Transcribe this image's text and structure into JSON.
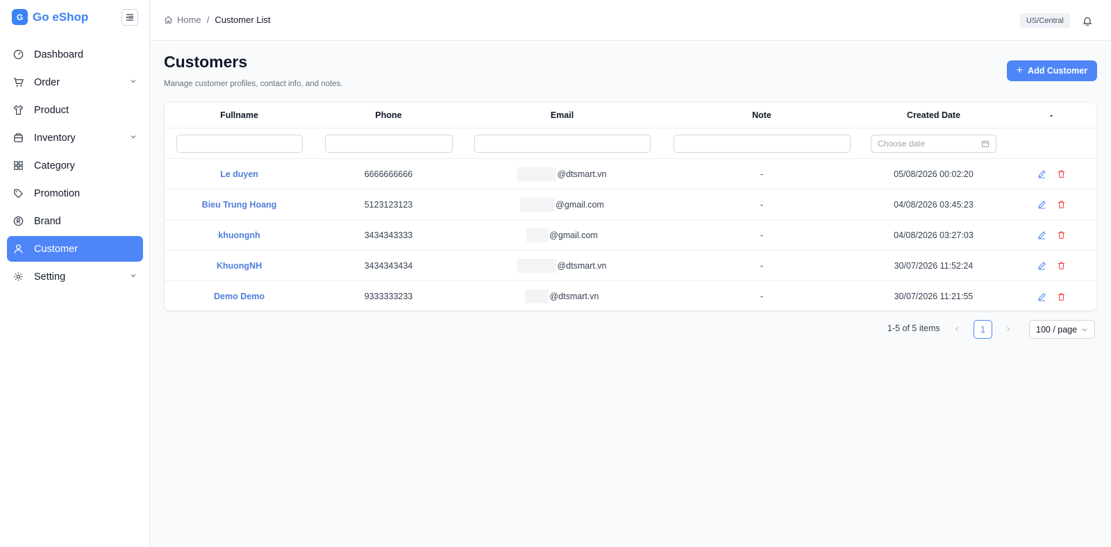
{
  "app": {
    "logo_letter": "G",
    "name": "Go eShop"
  },
  "sidebar": {
    "items": [
      {
        "label": "Dashboard",
        "icon": "dashboard-icon"
      },
      {
        "label": "Order",
        "icon": "cart-icon",
        "expandable": true
      },
      {
        "label": "Product",
        "icon": "shirt-icon"
      },
      {
        "label": "Inventory",
        "icon": "box-icon",
        "expandable": true
      },
      {
        "label": "Category",
        "icon": "grid-icon"
      },
      {
        "label": "Promotion",
        "icon": "tag-icon"
      },
      {
        "label": "Brand",
        "icon": "registered-icon"
      },
      {
        "label": "Customer",
        "icon": "user-icon",
        "active": true
      },
      {
        "label": "Setting",
        "icon": "gear-icon",
        "expandable": true
      }
    ]
  },
  "topbar": {
    "breadcrumb_home": "Home",
    "breadcrumb_sep": "/",
    "breadcrumb_current": "Customer List",
    "timezone": "US/Central"
  },
  "page": {
    "title": "Customers",
    "subtitle": "Manage customer profiles, contact info, and notes.",
    "add_button": "Add Customer"
  },
  "table": {
    "columns": [
      "Fullname",
      "Phone",
      "Email",
      "Note",
      "Created Date",
      "-"
    ],
    "date_placeholder": "Choose date",
    "rows": [
      {
        "name": "Le duyen",
        "phone": "6666666666",
        "email": "@dtsmart.vn",
        "note": "-",
        "created": "05/08/2026 00:02:20"
      },
      {
        "name": "Bieu Trung Hoang",
        "phone": "5123123123",
        "email": "@gmail.com",
        "note": "-",
        "created": "04/08/2026 03:45:23"
      },
      {
        "name": "khuongnh",
        "phone": "3434343333",
        "email": "@gmail.com",
        "note": "-",
        "created": "04/08/2026 03:27:03"
      },
      {
        "name": "KhuongNH",
        "phone": "3434343434",
        "email": "@dtsmart.vn",
        "note": "-",
        "created": "30/07/2026 11:52:24"
      },
      {
        "name": "Demo Demo",
        "phone": "9333333233",
        "email": "@dtsmart.vn",
        "note": "-",
        "created": "30/07/2026 11:21:55"
      }
    ]
  },
  "pagination": {
    "total_text": "1-5 of 5 items",
    "current_page": "1",
    "page_size": "100 / page"
  },
  "colors": {
    "accent": "#4f86f7",
    "link": "#4f7fdb",
    "danger": "#ef4444"
  }
}
